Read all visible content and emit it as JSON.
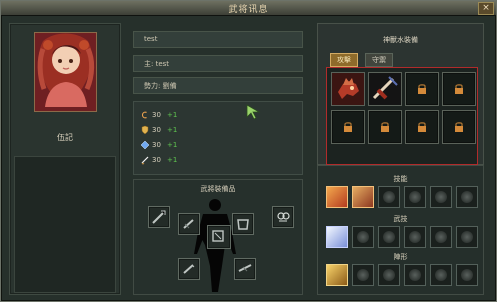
{
  "window": {
    "title": "武将讯息",
    "close_label": "×"
  },
  "portrait": {
    "name": "伍記"
  },
  "info": {
    "top_label": "test",
    "lord_text": "主: test",
    "faction_text": "勢力: 劉備"
  },
  "stats": [
    {
      "icon": "strength-icon",
      "value": "30",
      "bonus": "+1"
    },
    {
      "icon": "shield-icon",
      "value": "30",
      "bonus": "+1"
    },
    {
      "icon": "book-icon",
      "value": "30",
      "bonus": "+1"
    },
    {
      "icon": "sword-icon",
      "value": "30",
      "bonus": "+1"
    }
  ],
  "equipment": {
    "title": "武將裝備品"
  },
  "artifacts": {
    "title": "神獸水裝備",
    "tabs": [
      {
        "label": "攻擊",
        "active": true
      },
      {
        "label": "守禦",
        "active": false
      }
    ]
  },
  "skills": {
    "title": "技能",
    "martial_title": "武技",
    "formation_title": "陣形"
  }
}
